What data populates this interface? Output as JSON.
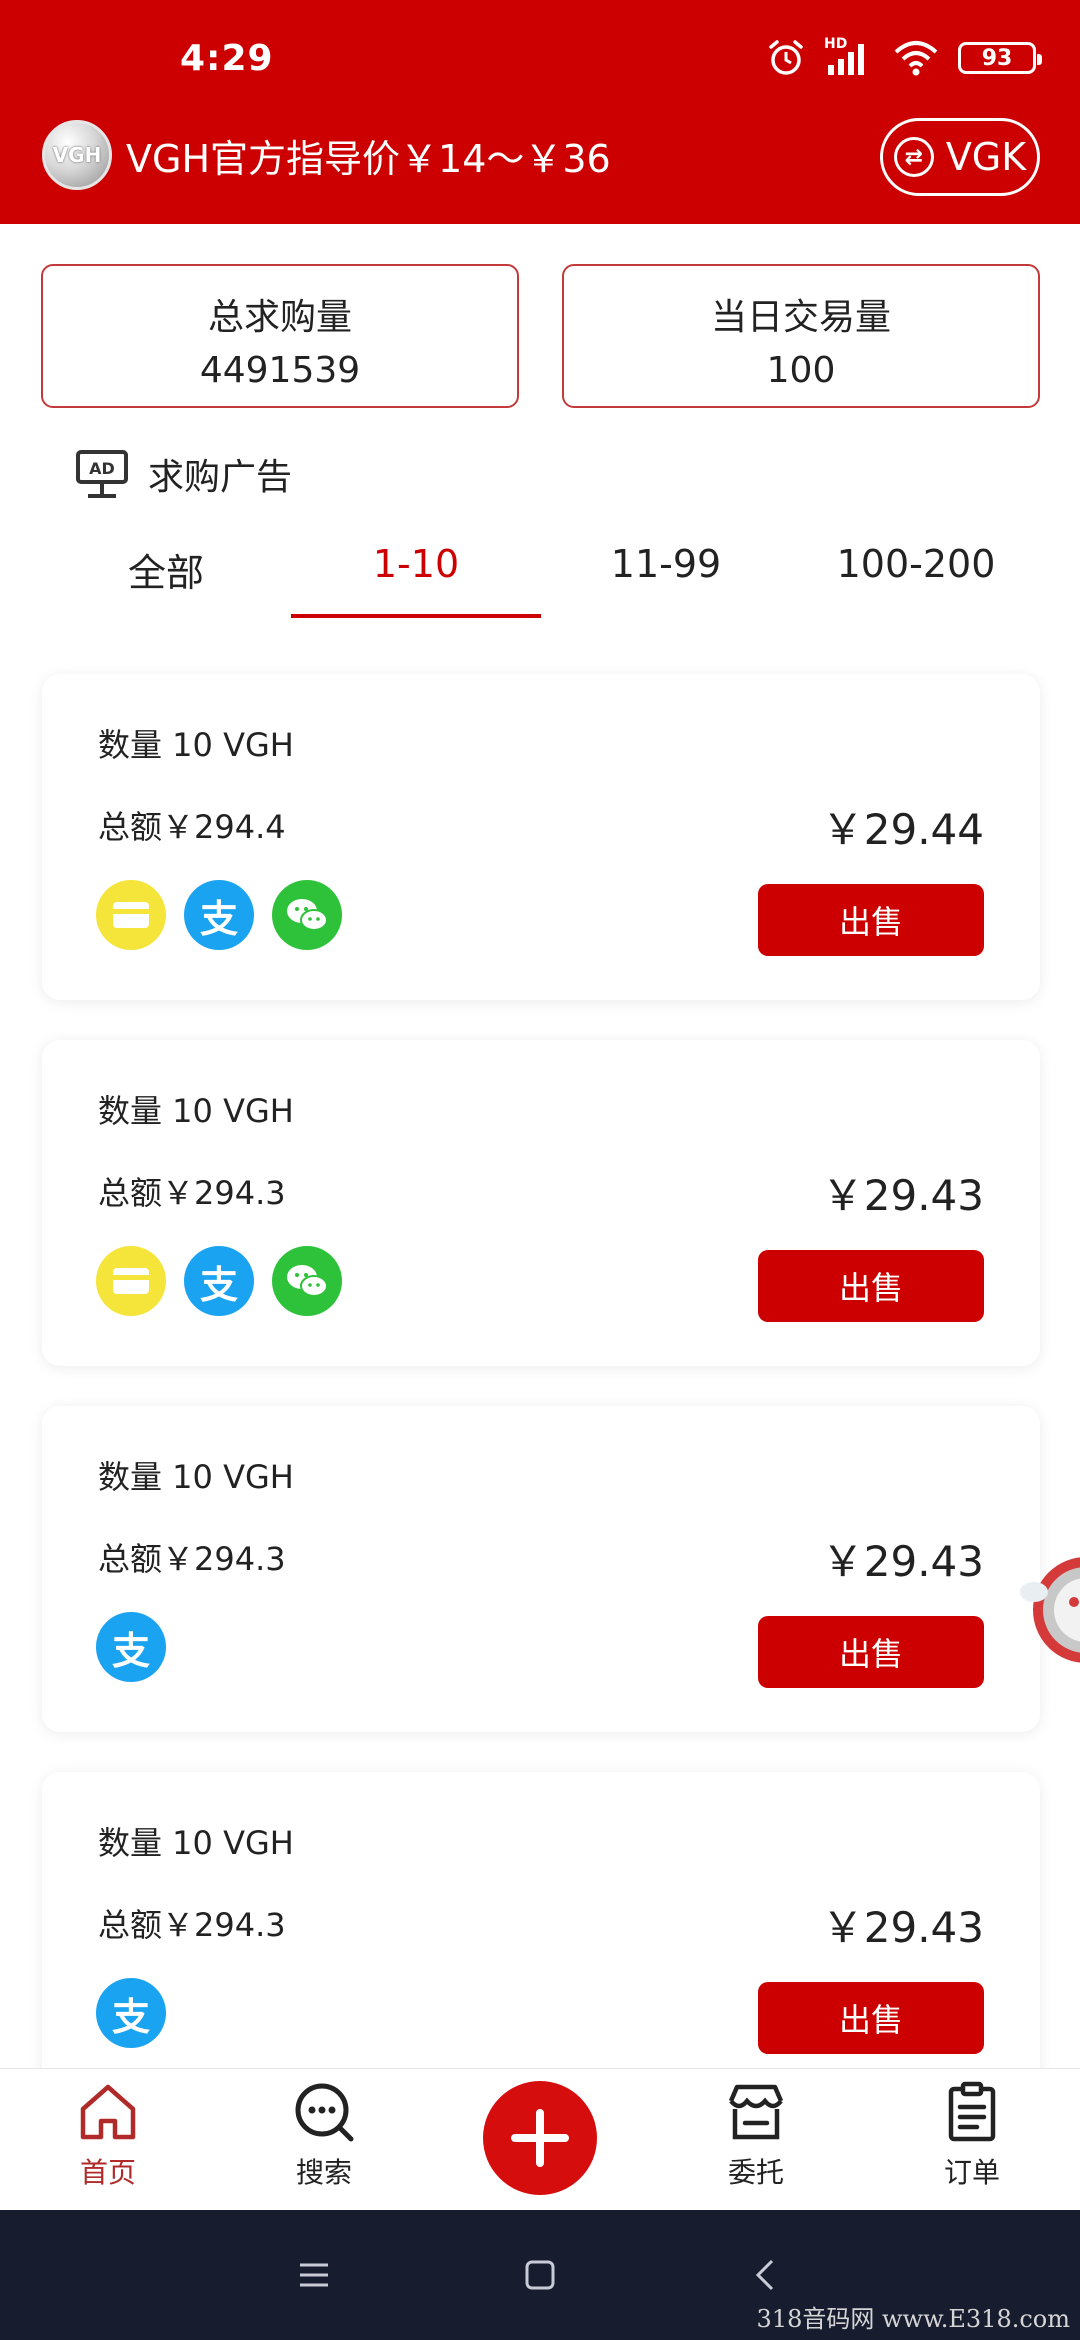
{
  "status_bar": {
    "time": "4:29",
    "hd": "HD",
    "battery": "93"
  },
  "header": {
    "logo_text": "VGH",
    "guide_price": "VGH官方指导价￥14～￥36",
    "switch_label": "VGK",
    "bg_color": "#cc0000"
  },
  "stats": {
    "total_buy": {
      "label": "总求购量",
      "value": "4491539"
    },
    "daily_volume": {
      "label": "当日交易量",
      "value": "100"
    }
  },
  "ad_section": {
    "title": "求购广告",
    "icon": "ad-monitor-icon",
    "tabs": [
      {
        "label": "全部",
        "active": false
      },
      {
        "label": "1-10",
        "active": true
      },
      {
        "label": "11-99",
        "active": false
      },
      {
        "label": "100-200",
        "active": false
      }
    ]
  },
  "listings": [
    {
      "quantity": "数量 10 VGH",
      "total": "总额￥294.4",
      "price": "￥29.44",
      "action": "出售",
      "payments": [
        "bank-card-icon",
        "alipay-icon",
        "wechat-pay-icon"
      ]
    },
    {
      "quantity": "数量 10 VGH",
      "total": "总额￥294.3",
      "price": "￥29.43",
      "action": "出售",
      "payments": [
        "bank-card-icon",
        "alipay-icon",
        "wechat-pay-icon"
      ]
    },
    {
      "quantity": "数量 10 VGH",
      "total": "总额￥294.3",
      "price": "￥29.43",
      "action": "出售",
      "payments": [
        "alipay-icon"
      ]
    },
    {
      "quantity": "数量 10 VGH",
      "total": "总额￥294.3",
      "price": "￥29.43",
      "action": "出售",
      "payments": [
        "alipay-icon"
      ]
    }
  ],
  "alipay_glyph": "支",
  "bottom_nav": {
    "home": "首页",
    "search": "搜索",
    "entrust": "委托",
    "orders": "订单"
  },
  "watermark": "318音码网 www.E318.com"
}
